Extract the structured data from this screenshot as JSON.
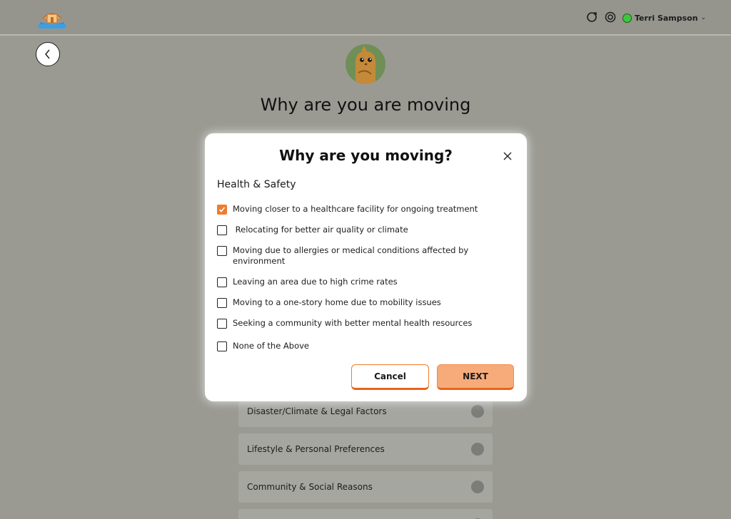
{
  "header": {
    "user_name": "Terri Sampson",
    "accent_color": "#f07c2d"
  },
  "page": {
    "title": "Why are you are moving"
  },
  "categories": [
    {
      "label": "Disaster/Climate & Legal Factors"
    },
    {
      "label": "Lifestyle & Personal Preferences"
    },
    {
      "label": "Community & Social Reasons"
    }
  ],
  "modal": {
    "title": "Why are you moving?",
    "section_title": "Health & Safety",
    "options": [
      {
        "label": "Moving closer to a healthcare facility for ongoing treatment",
        "checked": true
      },
      {
        "label": " Relocating for better air quality or climate",
        "checked": false
      },
      {
        "label": "Moving due to allergies or medical conditions affected by environment",
        "checked": false
      },
      {
        "label": "Leaving an area due to high crime rates",
        "checked": false
      },
      {
        "label": "Moving to a one-story home due to mobility issues",
        "checked": false
      },
      {
        "label": "Seeking a community with better mental health resources",
        "checked": false
      },
      {
        "label": "None of the Above",
        "checked": false
      }
    ],
    "cancel_label": "Cancel",
    "next_label": "NEXT"
  }
}
